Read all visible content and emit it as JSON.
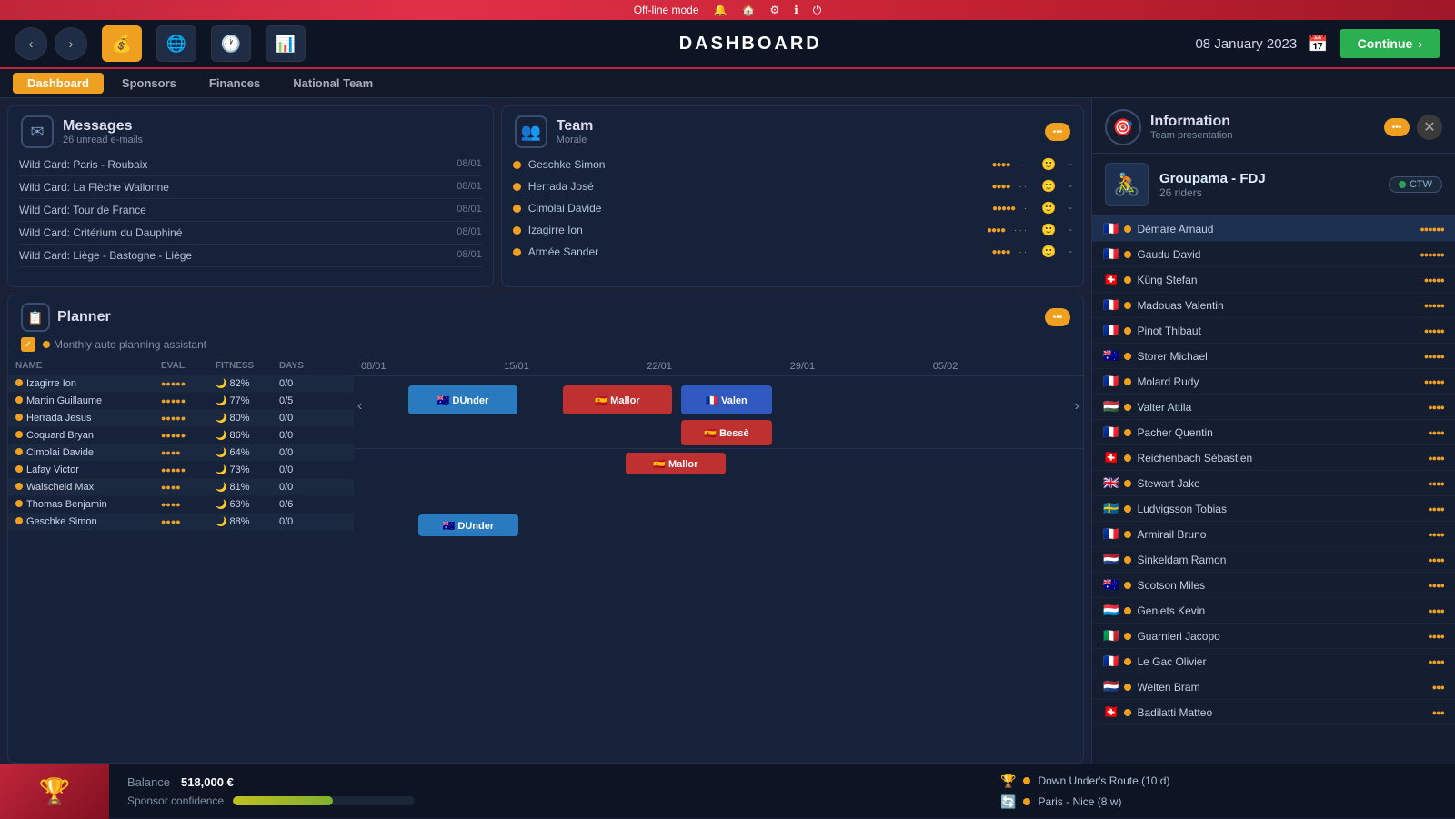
{
  "topbar": {
    "mode": "Off-line mode",
    "icons": [
      "🔔",
      "🏠",
      "⚙",
      "ℹ",
      "⏻"
    ]
  },
  "header": {
    "title": "DASHBOARD",
    "date": "08 January 2023",
    "continue_label": "Continue",
    "back": "‹",
    "forward": "›"
  },
  "tabs": [
    {
      "label": "Dashboard",
      "active": true
    },
    {
      "label": "Sponsors",
      "active": false
    },
    {
      "label": "Finances",
      "active": false
    },
    {
      "label": "National Team",
      "active": false
    }
  ],
  "messages": {
    "title": "Messages",
    "subtitle": "26 unread e-mails",
    "items": [
      {
        "text": "Wild Card: Paris - Roubaix",
        "date": "08/01"
      },
      {
        "text": "Wild Card: La Flèche Wallonne",
        "date": "08/01"
      },
      {
        "text": "Wild Card: Tour de France",
        "date": "08/01"
      },
      {
        "text": "Wild Card: Critérium du Dauphiné",
        "date": "08/01"
      },
      {
        "text": "Wild Card: Liège - Bastogne - Liège",
        "date": "08/01"
      }
    ]
  },
  "team": {
    "title": "Team",
    "subtitle": "Morale",
    "members": [
      {
        "name": "Geschke Simon",
        "stars": "●●●●",
        "extra": "· ·"
      },
      {
        "name": "Herrada José",
        "stars": "●●●●",
        "extra": "· ·"
      },
      {
        "name": "Cimolai Davide",
        "stars": "●●●●●",
        "extra": "·"
      },
      {
        "name": "Izagirre Ion",
        "stars": "●●●●",
        "extra": "· · ·"
      },
      {
        "name": "Armée Sander",
        "stars": "●●●●",
        "extra": "· ·"
      }
    ]
  },
  "planner": {
    "title": "Planner",
    "auto_label": "Monthly auto planning assistant",
    "dates": [
      "08/01",
      "15/01",
      "22/01",
      "29/01",
      "05/02"
    ],
    "columns": [
      "NAME",
      "EVAL.",
      "FITNESS",
      "DAYS"
    ],
    "riders": [
      {
        "name": "Izagirre Ion",
        "eval": "●●●●●",
        "fitness": "82%",
        "days": "0/0"
      },
      {
        "name": "Martin Guillaume",
        "eval": "●●●●●",
        "fitness": "77%",
        "days": "0/5"
      },
      {
        "name": "Herrada Jesus",
        "eval": "●●●●●",
        "fitness": "80%",
        "days": "0/0"
      },
      {
        "name": "Coquard Bryan",
        "eval": "●●●●●",
        "fitness": "86%",
        "days": "0/0"
      },
      {
        "name": "Cimolai Davide",
        "eval": "●●●●",
        "fitness": "64%",
        "days": "0/0"
      },
      {
        "name": "Lafay Victor",
        "eval": "●●●●●",
        "fitness": "73%",
        "days": "0/0"
      },
      {
        "name": "Walscheid Max",
        "eval": "●●●●",
        "fitness": "81%",
        "days": "0/0"
      },
      {
        "name": "Thomas Benjamin",
        "eval": "●●●●",
        "fitness": "63%",
        "days": "0/6"
      },
      {
        "name": "Geschke Simon",
        "eval": "●●●●",
        "fitness": "88%",
        "days": "0/0"
      }
    ],
    "races": [
      {
        "name": "DUnder",
        "style": "aus",
        "col_start": 2,
        "col_end": 3
      },
      {
        "name": "Mallor",
        "style": "esp",
        "col_start": 3,
        "col_end": 4
      },
      {
        "name": "Valen",
        "style": "fra",
        "col_start": 4,
        "col_end": 5
      },
      {
        "name": "Bessè",
        "style": "esp",
        "col_start": 4,
        "col_end": 5
      }
    ]
  },
  "information": {
    "title": "Information",
    "subtitle": "Team presentation",
    "team_name": "Groupama - FDJ",
    "riders_count": "26 riders",
    "ctw_label": "CTW",
    "riders": [
      {
        "name": "Démare Arnaud",
        "flag": "🇫🇷",
        "stars": "●●●●●●"
      },
      {
        "name": "Gaudu David",
        "flag": "🇫🇷",
        "stars": "●●●●●●"
      },
      {
        "name": "Küng Stefan",
        "flag": "🇨🇭",
        "stars": "●●●●●"
      },
      {
        "name": "Madouas Valentin",
        "flag": "🇫🇷",
        "stars": "●●●●●"
      },
      {
        "name": "Pinot Thibaut",
        "flag": "🇫🇷",
        "stars": "●●●●●"
      },
      {
        "name": "Storer Michael",
        "flag": "🇦🇺",
        "stars": "●●●●●"
      },
      {
        "name": "Molard Rudy",
        "flag": "🇫🇷",
        "stars": "●●●●●"
      },
      {
        "name": "Valter Attila",
        "flag": "🇭🇺",
        "stars": "●●●●"
      },
      {
        "name": "Pacher Quentin",
        "flag": "🇫🇷",
        "stars": "●●●●"
      },
      {
        "name": "Reichenbach Sébastien",
        "flag": "🇨🇭",
        "stars": "●●●●"
      },
      {
        "name": "Stewart Jake",
        "flag": "🇬🇧",
        "stars": "●●●●"
      },
      {
        "name": "Ludvigsson Tobias",
        "flag": "🇸🇪",
        "stars": "●●●●"
      },
      {
        "name": "Armirail Bruno",
        "flag": "🇫🇷",
        "stars": "●●●●"
      },
      {
        "name": "Sinkeldam Ramon",
        "flag": "🇳🇱",
        "stars": "●●●●"
      },
      {
        "name": "Scotson Miles",
        "flag": "🇦🇺",
        "stars": "●●●●"
      },
      {
        "name": "Geniets Kevin",
        "flag": "🇱🇺",
        "stars": "●●●●"
      },
      {
        "name": "Guarnieri Jacopo",
        "flag": "🇮🇹",
        "stars": "●●●●"
      },
      {
        "name": "Le Gac Olivier",
        "flag": "🇫🇷",
        "stars": "●●●●"
      },
      {
        "name": "Welten Bram",
        "flag": "🇳🇱",
        "stars": "●●●"
      },
      {
        "name": "Badilatti Matteo",
        "flag": "🇨🇭",
        "stars": "●●●"
      }
    ]
  },
  "bottombar": {
    "emoji": "🏆",
    "balance_label": "Balance",
    "balance_value": "518,000 €",
    "sponsor_label": "Sponsor confidence",
    "races": [
      {
        "icon": "🏆",
        "name": "Down Under's Route (10 d)"
      },
      {
        "icon": "🔄",
        "name": "Paris - Nice (8 w)"
      }
    ]
  }
}
